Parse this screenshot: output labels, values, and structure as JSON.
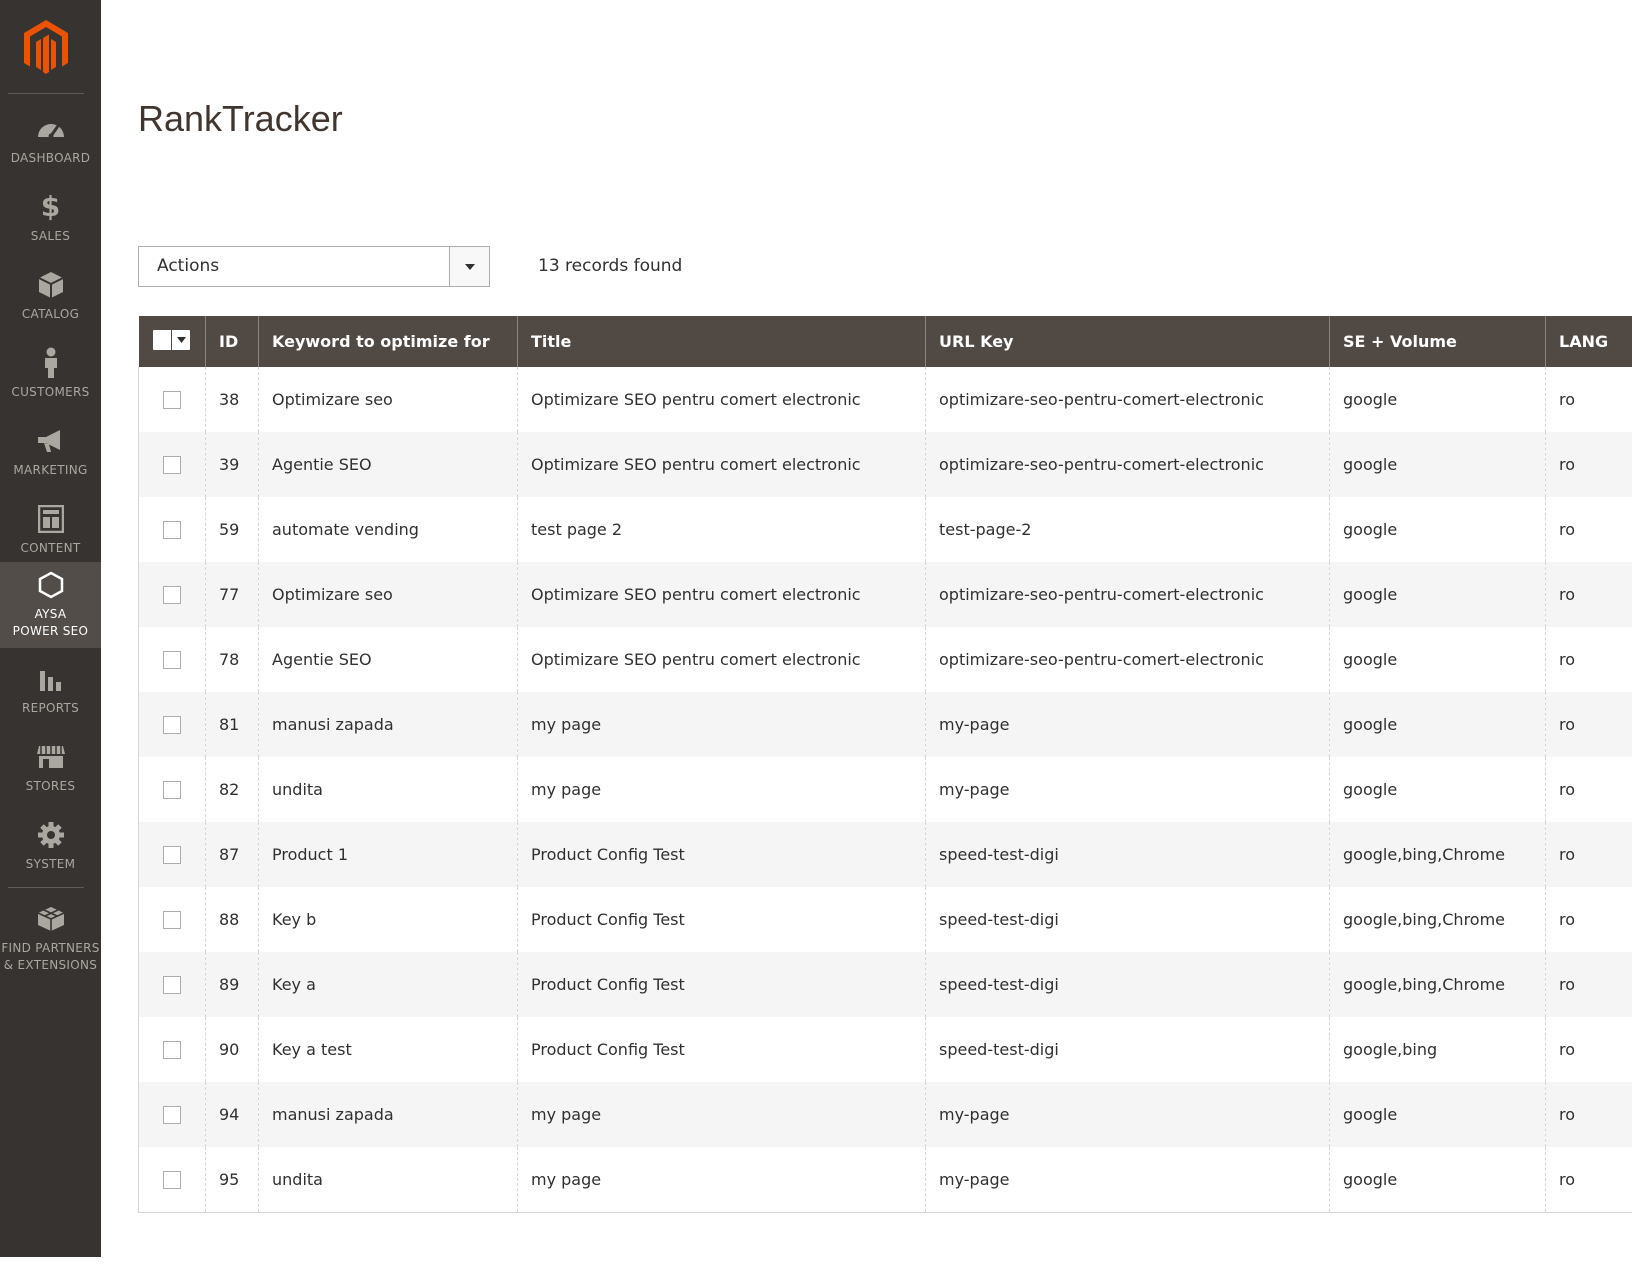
{
  "sidebar": {
    "logo": "magento-logo",
    "items": [
      {
        "label": "DASHBOARD",
        "icon": "dashboard-gauge-icon"
      },
      {
        "label": "SALES",
        "icon": "dollar-icon"
      },
      {
        "label": "CATALOG",
        "icon": "box-icon"
      },
      {
        "label": "CUSTOMERS",
        "icon": "person-icon"
      },
      {
        "label": "MARKETING",
        "icon": "megaphone-icon"
      },
      {
        "label": "CONTENT",
        "icon": "layout-icon"
      },
      {
        "label": "AYSA POWER SEO",
        "icon": "hexagon-icon",
        "active": true
      },
      {
        "label": "REPORTS",
        "icon": "bar-chart-icon"
      },
      {
        "label": "STORES",
        "icon": "storefront-icon"
      },
      {
        "label": "SYSTEM",
        "icon": "gear-icon"
      },
      {
        "label": "FIND PARTNERS & EXTENSIONS",
        "icon": "cubes-icon"
      }
    ]
  },
  "page": {
    "title": "RankTracker"
  },
  "toolbar": {
    "actions_label": "Actions",
    "records_found": "13 records found"
  },
  "grid": {
    "columns": [
      "ID",
      "Keyword to optimize for",
      "Title",
      "URL Key",
      "SE + Volume",
      "LANG"
    ],
    "rows": [
      {
        "id": "38",
        "keyword": "Optimizare seo",
        "title": "Optimizare SEO pentru comert electronic",
        "url_key": "optimizare-seo-pentru-comert-electronic",
        "se_volume": "google",
        "lang": "ro"
      },
      {
        "id": "39",
        "keyword": "Agentie SEO",
        "title": "Optimizare SEO pentru comert electronic",
        "url_key": "optimizare-seo-pentru-comert-electronic",
        "se_volume": "google",
        "lang": "ro"
      },
      {
        "id": "59",
        "keyword": "automate vending",
        "title": "test page 2",
        "url_key": "test-page-2",
        "se_volume": "google",
        "lang": "ro"
      },
      {
        "id": "77",
        "keyword": "Optimizare seo",
        "title": "Optimizare SEO pentru comert electronic",
        "url_key": "optimizare-seo-pentru-comert-electronic",
        "se_volume": "google",
        "lang": "ro"
      },
      {
        "id": "78",
        "keyword": "Agentie SEO",
        "title": "Optimizare SEO pentru comert electronic",
        "url_key": "optimizare-seo-pentru-comert-electronic",
        "se_volume": "google",
        "lang": "ro"
      },
      {
        "id": "81",
        "keyword": "manusi zapada",
        "title": "my page",
        "url_key": "my-page",
        "se_volume": "google",
        "lang": "ro"
      },
      {
        "id": "82",
        "keyword": "undita",
        "title": "my page",
        "url_key": "my-page",
        "se_volume": "google",
        "lang": "ro"
      },
      {
        "id": "87",
        "keyword": "Product 1",
        "title": "Product Config Test",
        "url_key": "speed-test-digi",
        "se_volume": "google,bing,Chrome",
        "lang": "ro"
      },
      {
        "id": "88",
        "keyword": "Key b",
        "title": "Product Config Test",
        "url_key": "speed-test-digi",
        "se_volume": "google,bing,Chrome",
        "lang": "ro"
      },
      {
        "id": "89",
        "keyword": "Key a",
        "title": "Product Config Test",
        "url_key": "speed-test-digi",
        "se_volume": "google,bing,Chrome",
        "lang": "ro"
      },
      {
        "id": "90",
        "keyword": "Key a test",
        "title": "Product Config Test",
        "url_key": "speed-test-digi",
        "se_volume": "google,bing",
        "lang": "ro"
      },
      {
        "id": "94",
        "keyword": "manusi zapada",
        "title": "my page",
        "url_key": "my-page",
        "se_volume": "google",
        "lang": "ro"
      },
      {
        "id": "95",
        "keyword": "undita",
        "title": "my page",
        "url_key": "my-page",
        "se_volume": "google",
        "lang": "ro"
      }
    ]
  },
  "colors": {
    "sidebar_bg": "#373330",
    "sidebar_active": "#524d49",
    "header_bg": "#514943",
    "brand_orange": "#eb5202"
  }
}
